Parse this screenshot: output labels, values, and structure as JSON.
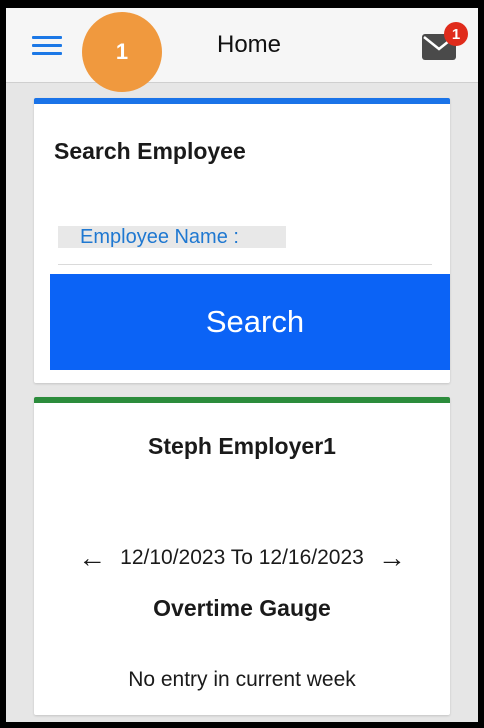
{
  "header": {
    "title": "Home",
    "step_badge": "1",
    "mail_badge_count": "1",
    "menu_icon": "hamburger-menu-icon",
    "mail_icon": "mail-icon"
  },
  "search_card": {
    "title": "Search Employee",
    "field_label": "Employee Name :",
    "field_value": "",
    "button_label": "Search",
    "accent_color": "#1a73e8"
  },
  "employer_card": {
    "name": "Steph Employer1",
    "date_range": "12/10/2023 To 12/16/2023",
    "prev_icon": "arrow-left-icon",
    "next_icon": "arrow-right-icon",
    "gauge_title": "Overtime Gauge",
    "status_text": "No entry in current week",
    "accent_color": "#2c8c3c"
  }
}
